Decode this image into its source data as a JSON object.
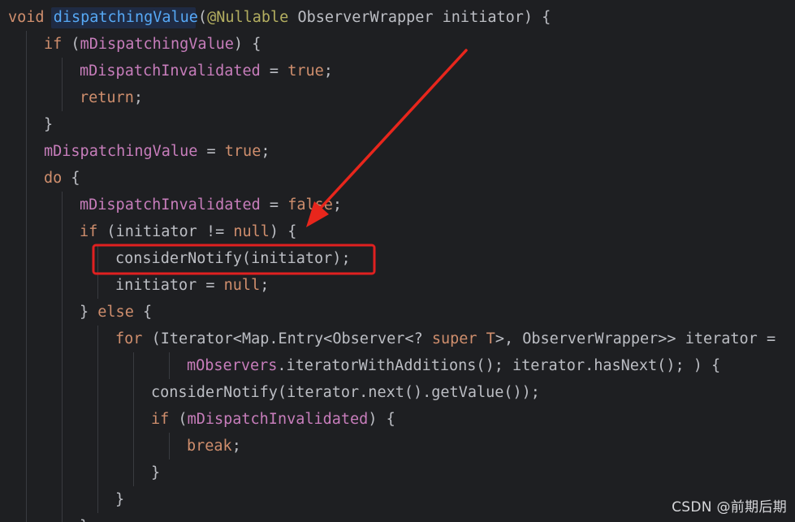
{
  "code": {
    "lines": [
      {
        "indent": 0,
        "tokens": [
          {
            "t": "void ",
            "k": "kw"
          },
          {
            "t": "dispatchingValue",
            "k": "fn"
          },
          {
            "t": "(",
            "k": "plain"
          },
          {
            "t": "@Nullable ",
            "k": "ann"
          },
          {
            "t": "ObserverWrapper initiator) {",
            "k": "plain"
          }
        ]
      },
      {
        "indent": 1,
        "tokens": [
          {
            "t": "if ",
            "k": "kw"
          },
          {
            "t": "(",
            "k": "plain"
          },
          {
            "t": "mDispatchingValue",
            "k": "fld"
          },
          {
            "t": ") {",
            "k": "plain"
          }
        ]
      },
      {
        "indent": 2,
        "tokens": [
          {
            "t": "mDispatchInvalidated",
            "k": "fld"
          },
          {
            "t": " = ",
            "k": "plain"
          },
          {
            "t": "true",
            "k": "kw"
          },
          {
            "t": ";",
            "k": "plain"
          }
        ]
      },
      {
        "indent": 2,
        "tokens": [
          {
            "t": "return",
            "k": "kw"
          },
          {
            "t": ";",
            "k": "plain"
          }
        ]
      },
      {
        "indent": 1,
        "tokens": [
          {
            "t": "}",
            "k": "plain"
          }
        ]
      },
      {
        "indent": 1,
        "tokens": [
          {
            "t": "mDispatchingValue",
            "k": "fld"
          },
          {
            "t": " = ",
            "k": "plain"
          },
          {
            "t": "true",
            "k": "kw"
          },
          {
            "t": ";",
            "k": "plain"
          }
        ]
      },
      {
        "indent": 1,
        "tokens": [
          {
            "t": "do ",
            "k": "kw"
          },
          {
            "t": "{",
            "k": "plain"
          }
        ]
      },
      {
        "indent": 2,
        "tokens": [
          {
            "t": "mDispatchInvalidated",
            "k": "fld"
          },
          {
            "t": " = ",
            "k": "plain"
          },
          {
            "t": "false",
            "k": "kw"
          },
          {
            "t": ";",
            "k": "plain"
          }
        ]
      },
      {
        "indent": 2,
        "tokens": [
          {
            "t": "if ",
            "k": "kw"
          },
          {
            "t": "(initiator != ",
            "k": "plain"
          },
          {
            "t": "null",
            "k": "kw"
          },
          {
            "t": ") {",
            "k": "plain"
          }
        ]
      },
      {
        "indent": 3,
        "tokens": [
          {
            "t": "considerNotify(initiator);",
            "k": "plain"
          }
        ]
      },
      {
        "indent": 3,
        "tokens": [
          {
            "t": "initiator = ",
            "k": "plain"
          },
          {
            "t": "null",
            "k": "kw"
          },
          {
            "t": ";",
            "k": "plain"
          }
        ]
      },
      {
        "indent": 2,
        "tokens": [
          {
            "t": "} ",
            "k": "plain"
          },
          {
            "t": "else ",
            "k": "kw"
          },
          {
            "t": "{",
            "k": "plain"
          }
        ]
      },
      {
        "indent": 3,
        "tokens": [
          {
            "t": "for ",
            "k": "kw"
          },
          {
            "t": "(Iterator<Map.Entry<Observer<? ",
            "k": "plain"
          },
          {
            "t": "super ",
            "k": "kw"
          },
          {
            "t": "T",
            "k": "tp"
          },
          {
            "t": ">, ObserverWrapper>> iterator =",
            "k": "plain"
          }
        ]
      },
      {
        "indent": 5,
        "tokens": [
          {
            "t": "mObservers",
            "k": "fld"
          },
          {
            "t": ".iteratorWithAdditions(); iterator.hasNext(); ) {",
            "k": "plain"
          }
        ]
      },
      {
        "indent": 4,
        "tokens": [
          {
            "t": "considerNotify(iterator.next().getValue());",
            "k": "plain"
          }
        ]
      },
      {
        "indent": 4,
        "tokens": [
          {
            "t": "if ",
            "k": "kw"
          },
          {
            "t": "(",
            "k": "plain"
          },
          {
            "t": "mDispatchInvalidated",
            "k": "fld"
          },
          {
            "t": ") {",
            "k": "plain"
          }
        ]
      },
      {
        "indent": 5,
        "tokens": [
          {
            "t": "break",
            "k": "kw"
          },
          {
            "t": ";",
            "k": "plain"
          }
        ]
      },
      {
        "indent": 4,
        "tokens": [
          {
            "t": "}",
            "k": "plain"
          }
        ]
      },
      {
        "indent": 3,
        "tokens": [
          {
            "t": "}",
            "k": "plain"
          }
        ]
      },
      {
        "indent": 2,
        "tokens": [
          {
            "t": "}",
            "k": "plain"
          }
        ]
      }
    ]
  },
  "highlight": {
    "label": "highlighted-statement",
    "color": "#e02020"
  },
  "arrow": {
    "color": "#e8261c"
  },
  "colors": {
    "background": "#1e1f22",
    "keyword": "#cf8e6d",
    "function": "#56a8f5",
    "field": "#c77dbb",
    "annotation": "#b3ae60",
    "text": "#bcbec4"
  },
  "watermark": {
    "text": "CSDN @前期后期"
  }
}
